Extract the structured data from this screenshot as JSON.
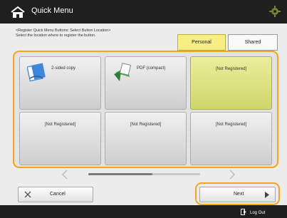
{
  "header": {
    "title": "Quick Menu",
    "icon": "home-menu-icon",
    "settings_icon": "settings-gear-icon"
  },
  "instructions": {
    "line1": "<Register Quick Menu Buttons: Select Button Location>",
    "line2": "Select the location where to register the button."
  },
  "tabs": {
    "personal": "Personal",
    "shared": "Shared",
    "selected": "Personal"
  },
  "tiles": [
    {
      "label": "2-sided copy",
      "icon": "copy-icon",
      "selected": false
    },
    {
      "label": "PDF (compact)",
      "icon": "scan-send-icon",
      "selected": false
    },
    {
      "label": "[Not Registered]",
      "selected": true
    },
    {
      "label": "[Not Registered]",
      "selected": false
    },
    {
      "label": "[Not Registered]",
      "selected": false
    },
    {
      "label": "[Not Registered]",
      "selected": false
    }
  ],
  "buttons": {
    "cancel": "Cancel",
    "next": "Next"
  },
  "footer": {
    "logout": "Log Out"
  },
  "colors": {
    "accent_outline": "#f4a51c",
    "selected_fill": "#f8ee84",
    "bar": "#1f1f1f"
  }
}
